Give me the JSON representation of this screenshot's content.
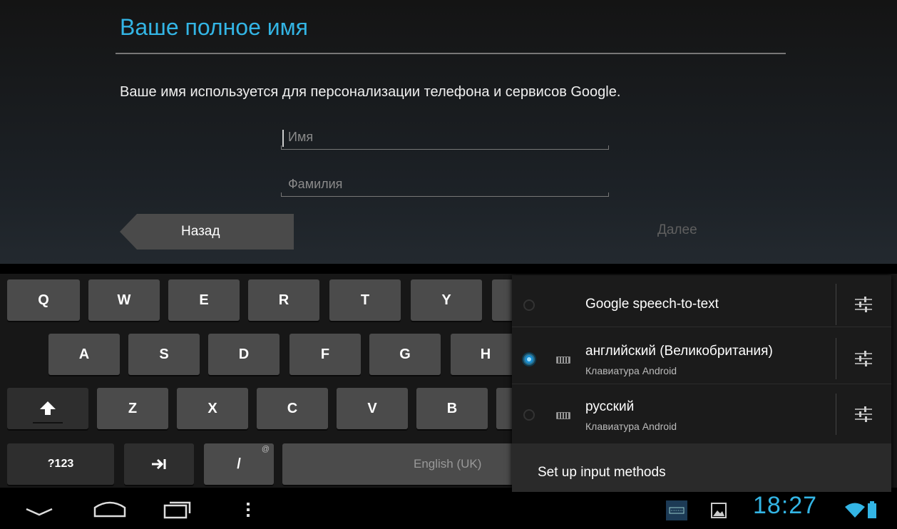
{
  "setup": {
    "title": "Ваше полное имя",
    "description": "Ваше имя используется для персонализации телефона и сервисов Google.",
    "first_name_placeholder": "Имя",
    "last_name_placeholder": "Фамилия",
    "back_label": "Назад",
    "next_label": "Далее"
  },
  "keyboard": {
    "row1": [
      "Q",
      "W",
      "E",
      "R",
      "T",
      "Y"
    ],
    "row2": [
      "A",
      "S",
      "D",
      "F",
      "G",
      "H"
    ],
    "row3": [
      "Z",
      "X",
      "C",
      "V",
      "B"
    ],
    "symbols_label": "?123",
    "slash_label": "/",
    "slash_alt": "@",
    "space_label": "English (UK)"
  },
  "input_methods_popup": {
    "options": [
      {
        "name": "Google speech-to-text",
        "subtitle": "",
        "selected": false
      },
      {
        "name": "английский (Великобритания)",
        "subtitle": "Клавиатура Android",
        "selected": true
      },
      {
        "name": "русский",
        "subtitle": "Клавиатура Android",
        "selected": false
      }
    ],
    "setup_label": "Set up input methods"
  },
  "status_bar": {
    "time": "18:27",
    "accent_color": "#33b5e5"
  },
  "icons": [
    "back-nav-icon",
    "home-nav-icon",
    "recent-apps-icon",
    "menu-icon",
    "keyboard-icon",
    "image-icon",
    "wifi-icon",
    "battery-icon",
    "settings-sliders-icon",
    "shift-icon",
    "tab-icon"
  ]
}
